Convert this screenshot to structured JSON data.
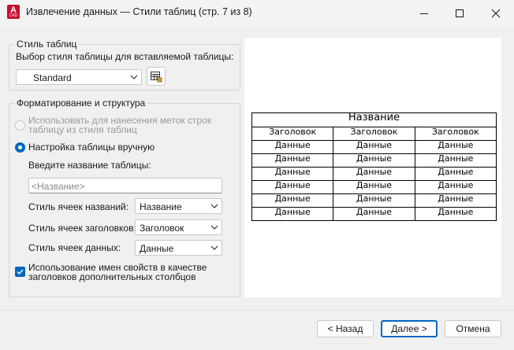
{
  "window": {
    "app_icon_letter": "A",
    "app_icon_sub": "CAD",
    "title": "Извлечение данных — Стили таблиц (стр. 7 из 8)"
  },
  "table_style": {
    "group_title": "Стиль таблиц",
    "select_label": "Выбор стиля таблицы для вставляемой таблицы:",
    "select_value": "Standard",
    "edit_icon": "table-style-icon"
  },
  "formatting": {
    "group_title": "Форматирование и структура",
    "option_use_style": "Использовать для нанесения меток строк таблицу из стиля таблиц",
    "option_manual": "Настройка таблицы вручную",
    "table_name_label": "Введите название таблицы:",
    "table_name_placeholder": "<Название>",
    "title_cell_label": "Стиль ячеек названий:",
    "title_cell_value": "Название",
    "header_cell_label": "Стиль ячеек заголовков:",
    "header_cell_value": "Заголовок",
    "data_cell_label": "Стиль ячеек данных:",
    "data_cell_value": "Данные",
    "use_property_names": "Использование имен свойств в качестве заголовков дополнительных столбцов",
    "use_property_names_checked": true
  },
  "preview": {
    "title": "Название",
    "headers": [
      "Заголовок",
      "Заголовок",
      "Заголовок"
    ],
    "rows": [
      [
        "Данные",
        "Данные",
        "Данные"
      ],
      [
        "Данные",
        "Данные",
        "Данные"
      ],
      [
        "Данные",
        "Данные",
        "Данные"
      ],
      [
        "Данные",
        "Данные",
        "Данные"
      ],
      [
        "Данные",
        "Данные",
        "Данные"
      ],
      [
        "Данные",
        "Данные",
        "Данные"
      ]
    ]
  },
  "buttons": {
    "back": "< Назад",
    "next": "Далее >",
    "cancel": "Отмена"
  },
  "colors": {
    "accent": "#0067c0",
    "app_icon": "#c8102e"
  }
}
